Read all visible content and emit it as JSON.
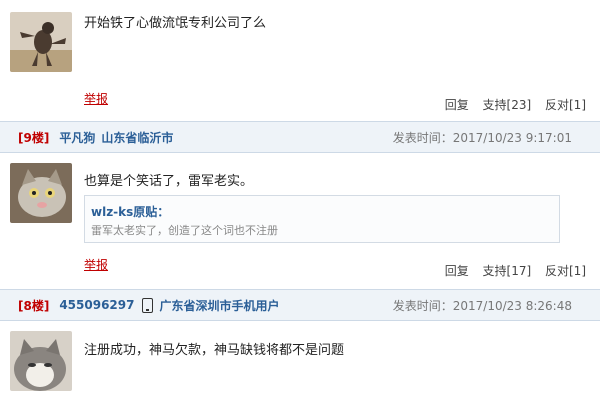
{
  "posts": [
    {
      "content": "开始铁了心做流氓专利公司了么",
      "report_label": "举报",
      "reply_label": "回复",
      "support_label": "支持[23]",
      "oppose_label": "反对[1]"
    },
    {
      "floor": "[9楼]",
      "user": "平凡狗",
      "location": "山东省临沂市",
      "time": "发表时间：2017/10/23 9:17:01",
      "content": "也算是个笑话了，雷军老实。",
      "quote_author": "wlz-ks原贴：",
      "quote_text": "雷军太老实了，创造了这个词也不注册",
      "report_label": "举报",
      "reply_label": "回复",
      "support_label": "支持[17]",
      "oppose_label": "反对[1]"
    },
    {
      "floor": "[8楼]",
      "user": "455096297",
      "location": "广东省深圳市手机用户",
      "time": "发表时间：2017/10/23 8:26:48",
      "content": "注册成功，神马欠款，神马缺钱将都不是问题"
    }
  ],
  "icons": {
    "phone": "mobile-phone-icon"
  },
  "colors": {
    "floor": "#c00000",
    "username": "#2b5f97",
    "header_bg": "#eef3f8"
  }
}
